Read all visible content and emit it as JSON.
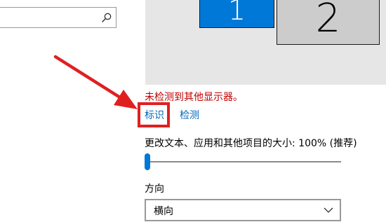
{
  "search": {
    "value": "",
    "placeholder": "",
    "icon": "search-icon"
  },
  "display_arrangement": {
    "monitors": [
      {
        "label": "1",
        "selected": true
      },
      {
        "label": "2",
        "selected": false
      }
    ]
  },
  "messages": {
    "not_detected": "未检测到其他显示器。"
  },
  "links": {
    "identify": "标识",
    "detect": "检测"
  },
  "scale": {
    "label": "更改文本、应用和其他项目的大小: 100% (推荐)",
    "slider_level": 0
  },
  "orientation": {
    "label": "方向",
    "selected": "横向",
    "icon": "chevron-down-icon"
  },
  "annotation": {
    "arrow_color": "#e02020",
    "highlight_color": "#e02020"
  },
  "colors": {
    "accent": "#0078d7",
    "link": "#0067b8",
    "error": "#c00000"
  }
}
